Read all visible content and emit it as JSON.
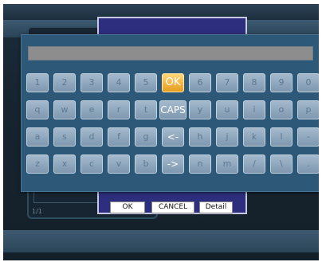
{
  "page_indicator": "1/1",
  "dialog": {
    "ok_label": "OK",
    "cancel_label": "CANCEL",
    "detail_label": "Detail"
  },
  "keyboard": {
    "input_value": "",
    "rows": [
      [
        "1",
        "2",
        "3",
        "4",
        "5",
        "OK",
        "6",
        "7",
        "8",
        "9",
        "0"
      ],
      [
        "q",
        "w",
        "e",
        "r",
        "t",
        "CAPS",
        "y",
        "u",
        "i",
        "o",
        "p"
      ],
      [
        "a",
        "s",
        "d",
        "f",
        "g",
        "<-",
        "h",
        "j",
        "k",
        "l",
        "-"
      ],
      [
        "z",
        "x",
        "c",
        "v",
        "b",
        "->",
        "n",
        "m",
        "/",
        "\\",
        "."
      ]
    ],
    "selected_key": "OK",
    "colors": {
      "selected": "#f3b13d",
      "key": "#8fa7bd",
      "panel": "#2e5878"
    }
  }
}
